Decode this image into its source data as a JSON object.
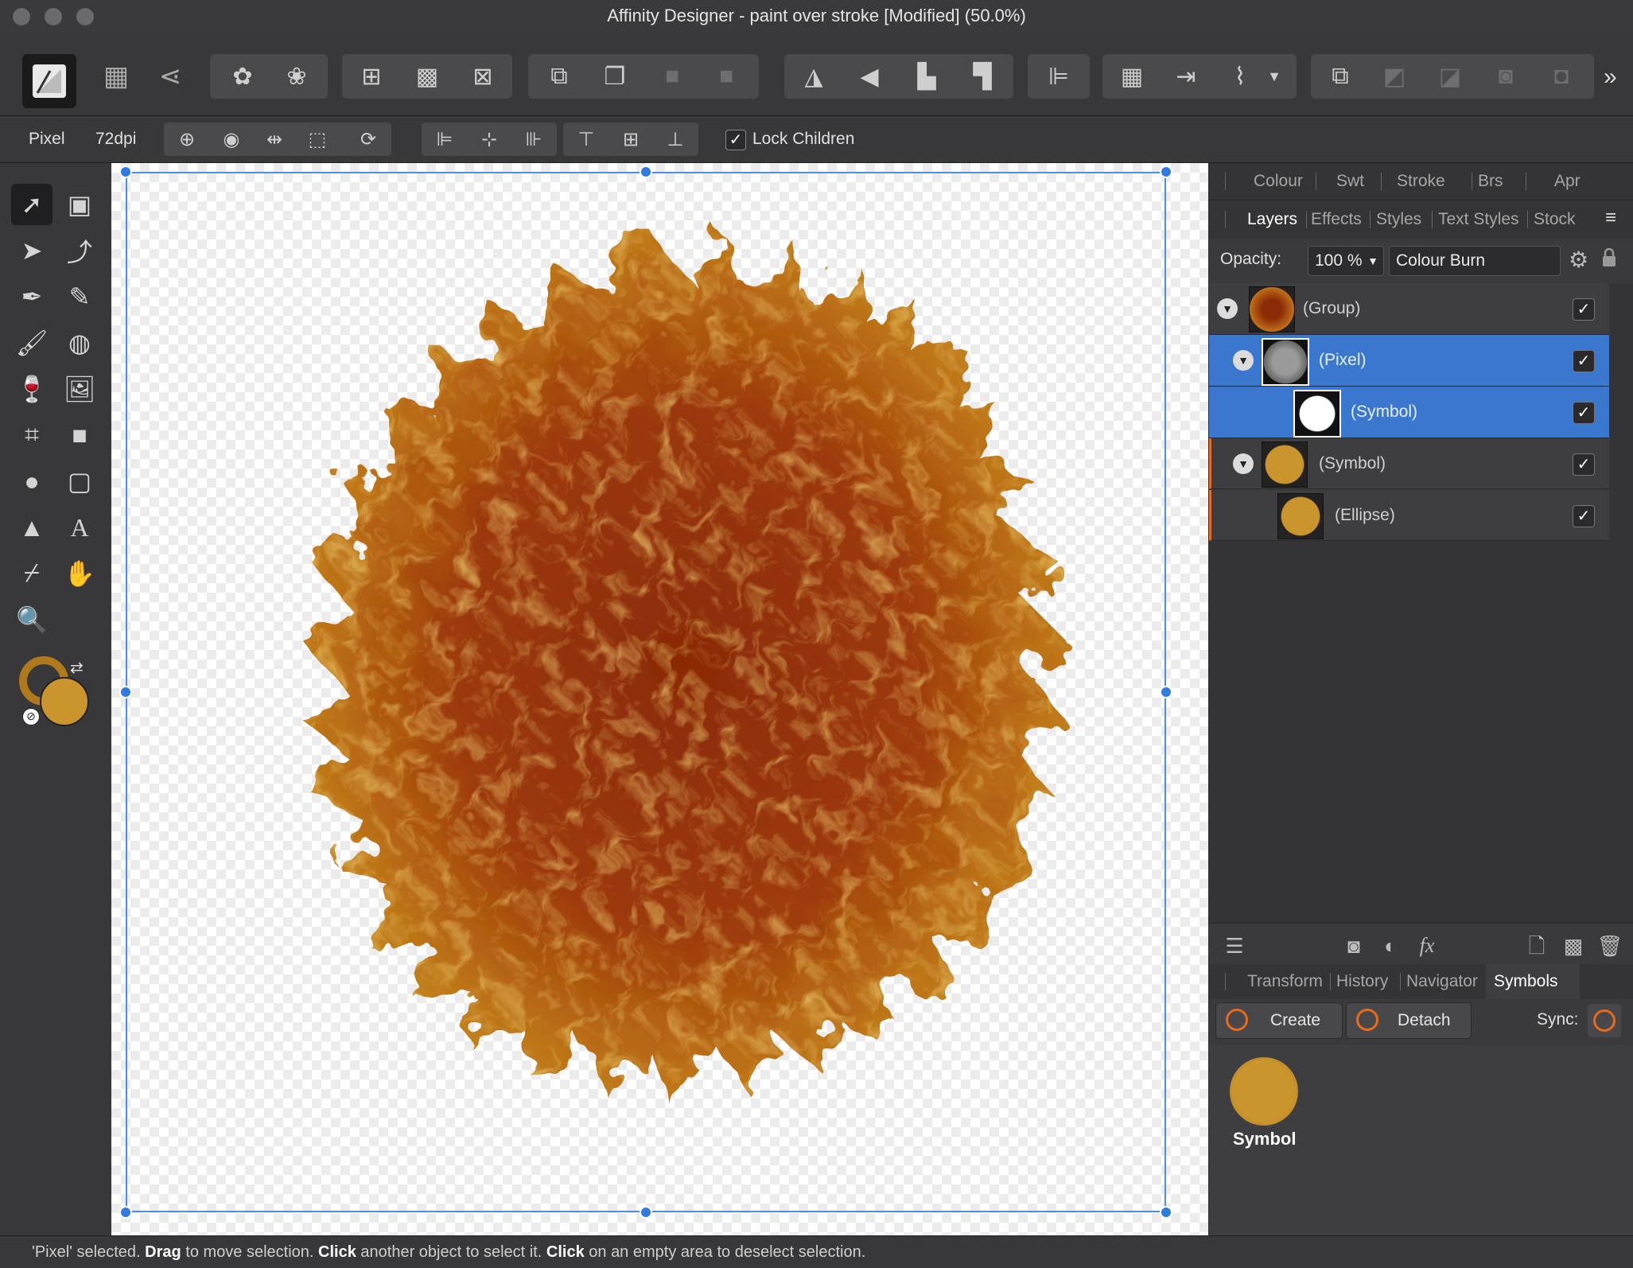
{
  "window": {
    "title": "Affinity Designer - paint over stroke [Modified] (50.0%)"
  },
  "toolbar": {
    "persona_icon": "designer-persona-icon",
    "more_label": "»"
  },
  "context_bar": {
    "layer_type": "Pixel",
    "dpi": "72dpi",
    "lock_children_label": "Lock Children",
    "lock_children_checked": true
  },
  "top_tabs": [
    "Colour",
    "Swt",
    "Stroke",
    "Brs",
    "Apr"
  ],
  "layer_tabs": {
    "items": [
      "Layers",
      "Effects",
      "Styles",
      "Text Styles",
      "Stock"
    ],
    "active": "Layers"
  },
  "opacity": {
    "label": "Opacity:",
    "value": "100 %",
    "blend_mode": "Colour Burn"
  },
  "layers": [
    {
      "name": "(Group)",
      "level": 0,
      "expanded": true,
      "selected": false,
      "visible": true
    },
    {
      "name": "(Pixel)",
      "level": 1,
      "expanded": true,
      "selected": true,
      "visible": true
    },
    {
      "name": "(Symbol)",
      "level": 2,
      "expanded": false,
      "selected": true,
      "visible": true
    },
    {
      "name": "(Symbol)",
      "level": 1,
      "expanded": true,
      "selected": false,
      "visible": true
    },
    {
      "name": "(Ellipse)",
      "level": 2,
      "expanded": false,
      "selected": false,
      "visible": true
    }
  ],
  "bottom_tabs": {
    "items": [
      "Transform",
      "History",
      "Navigator",
      "Symbols"
    ],
    "active": "Symbols"
  },
  "symbols_panel": {
    "create_label": "Create",
    "detach_label": "Detach",
    "sync_label": "Sync:",
    "symbol_name": "Symbol"
  },
  "colors": {
    "selection": "#3a78cf",
    "fill": "#c9952c",
    "stroke": "#b07a1c",
    "accent_orange": "#e86a1a"
  },
  "status": {
    "part1": "'Pixel' selected. ",
    "drag": "Drag",
    "part2": " to move selection. ",
    "click1": "Click",
    "part3": " another object to select it. ",
    "click2": "Click",
    "part4": " on an empty area to deselect selection."
  }
}
